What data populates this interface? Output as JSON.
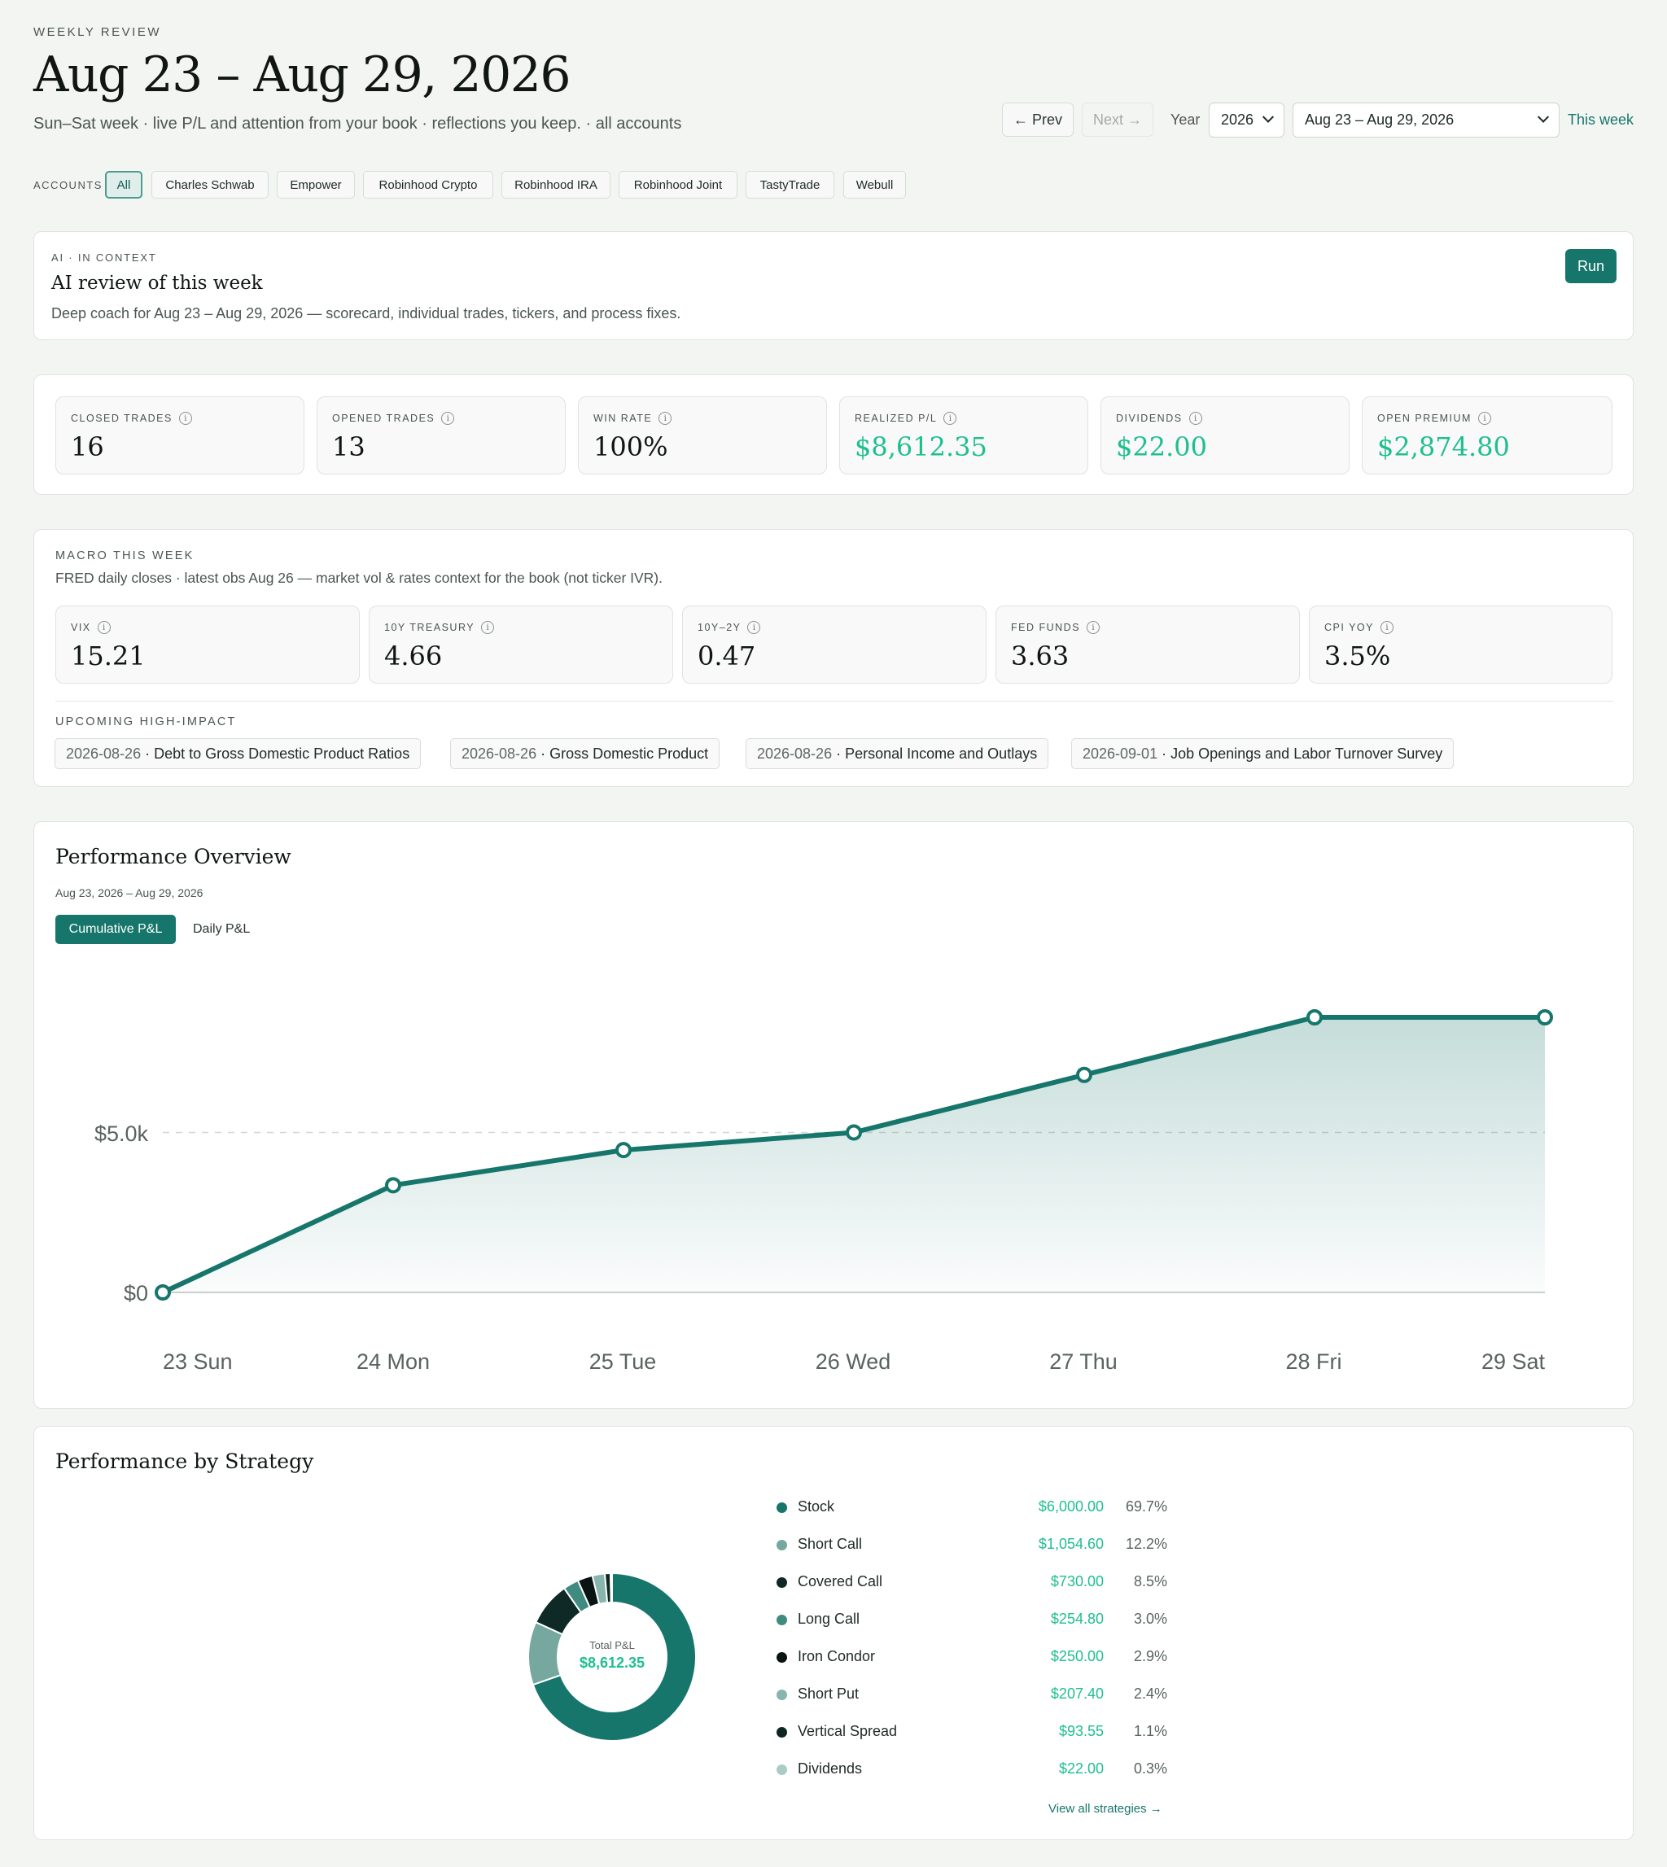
{
  "header": {
    "eyebrow": "WEEKLY REVIEW",
    "title": "Aug 23 – Aug 29, 2026",
    "subtitle": "Sun–Sat week · live P/L and attention from your book · reflections you keep. · all accounts",
    "prev_label": "← Prev",
    "next_label": "Next →",
    "year_label": "Year",
    "year_value": "2026",
    "week_value": "Aug 23 – Aug 29, 2026",
    "this_week_label": "This week"
  },
  "accounts": {
    "label": "ACCOUNTS",
    "items": [
      "All",
      "Charles Schwab",
      "Empower",
      "Robinhood Crypto",
      "Robinhood IRA",
      "Robinhood Joint",
      "TastyTrade",
      "Webull"
    ]
  },
  "ai": {
    "eyebrow": "AI · IN CONTEXT",
    "title": "AI review of this week",
    "description": "Deep coach for Aug 23 – Aug 29, 2026 — scorecard, individual trades, tickers, and process fixes.",
    "run_label": "Run"
  },
  "stats": [
    {
      "label": "CLOSED TRADES",
      "value": "16"
    },
    {
      "label": "OPENED TRADES",
      "value": "13"
    },
    {
      "label": "WIN RATE",
      "value": "100%"
    },
    {
      "label": "REALIZED P/L",
      "value": "$8,612.35"
    },
    {
      "label": "DIVIDENDS",
      "value": "$22.00"
    },
    {
      "label": "OPEN PREMIUM",
      "value": "$2,874.80"
    }
  ],
  "macro": {
    "label": "MACRO THIS WEEK",
    "description": "FRED daily closes · latest obs Aug 26 — market vol & rates context for the book (not ticker IVR).",
    "items": [
      {
        "label": "VIX",
        "value": "15.21"
      },
      {
        "label": "10Y TREASURY",
        "value": "4.66"
      },
      {
        "label": "10Y–2Y",
        "value": "0.47"
      },
      {
        "label": "FED FUNDS",
        "value": "3.63"
      },
      {
        "label": "CPI YOY",
        "value": "3.5%"
      }
    ],
    "upcoming_label": "UPCOMING HIGH-IMPACT",
    "events": [
      {
        "date": "2026-08-26",
        "sep": " · ",
        "name": "Debt to Gross Domestic Product Ratios"
      },
      {
        "date": "2026-08-26",
        "sep": " · ",
        "name": "Gross Domestic Product"
      },
      {
        "date": "2026-08-26",
        "sep": " · ",
        "name": "Personal Income and Outlays"
      },
      {
        "date": "2026-09-01",
        "sep": " · ",
        "name": "Job Openings and Labor Turnover Survey"
      }
    ]
  },
  "performance": {
    "title": "Performance Overview",
    "range": "Aug 23, 2026 – Aug 29, 2026",
    "tab_cumulative": "Cumulative P&L",
    "tab_daily": "Daily P&L"
  },
  "chart_data": {
    "type": "area",
    "title": "",
    "x": [
      "23 Sun",
      "24 Mon",
      "25 Tue",
      "26 Wed",
      "27 Thu",
      "28 Fri",
      "29 Sat"
    ],
    "series": [
      {
        "values": [
          0,
          3350,
          4450,
          5000,
          6800,
          8600,
          8600
        ]
      }
    ],
    "ytick_labels": [
      "$0",
      "$5.0k"
    ],
    "yticks": [
      0,
      5000
    ],
    "ylim": [
      0,
      8600
    ],
    "grid": "dashed at $5.0k",
    "colors": {
      "line": "#17766b",
      "fill": "#17766b"
    }
  },
  "strategy": {
    "title": "Performance by Strategy",
    "total_label": "Total P&L",
    "total_value": "$8,612.35",
    "items": [
      {
        "name": "Stock",
        "amount": "$6,000.00",
        "pct": "69.7%",
        "value": 69.7,
        "color": "#17766b"
      },
      {
        "name": "Short Call",
        "amount": "$1,054.60",
        "pct": "12.2%",
        "value": 12.2,
        "color": "#76a89f"
      },
      {
        "name": "Covered Call",
        "amount": "$730.00",
        "pct": "8.5%",
        "value": 8.5,
        "color": "#0f2a26"
      },
      {
        "name": "Long Call",
        "amount": "$254.80",
        "pct": "3.0%",
        "value": 3.0,
        "color": "#3f8b80"
      },
      {
        "name": "Iron Condor",
        "amount": "$250.00",
        "pct": "2.9%",
        "value": 2.9,
        "color": "#0a1412"
      },
      {
        "name": "Short Put",
        "amount": "$207.40",
        "pct": "2.4%",
        "value": 2.4,
        "color": "#88b5ad"
      },
      {
        "name": "Vertical Spread",
        "amount": "$93.55",
        "pct": "1.1%",
        "value": 1.1,
        "color": "#0e2622"
      },
      {
        "name": "Dividends",
        "amount": "$22.00",
        "pct": "0.3%",
        "value": 0.3,
        "color": "#a9cdc5"
      }
    ],
    "view_all_label": "View all strategies →"
  }
}
